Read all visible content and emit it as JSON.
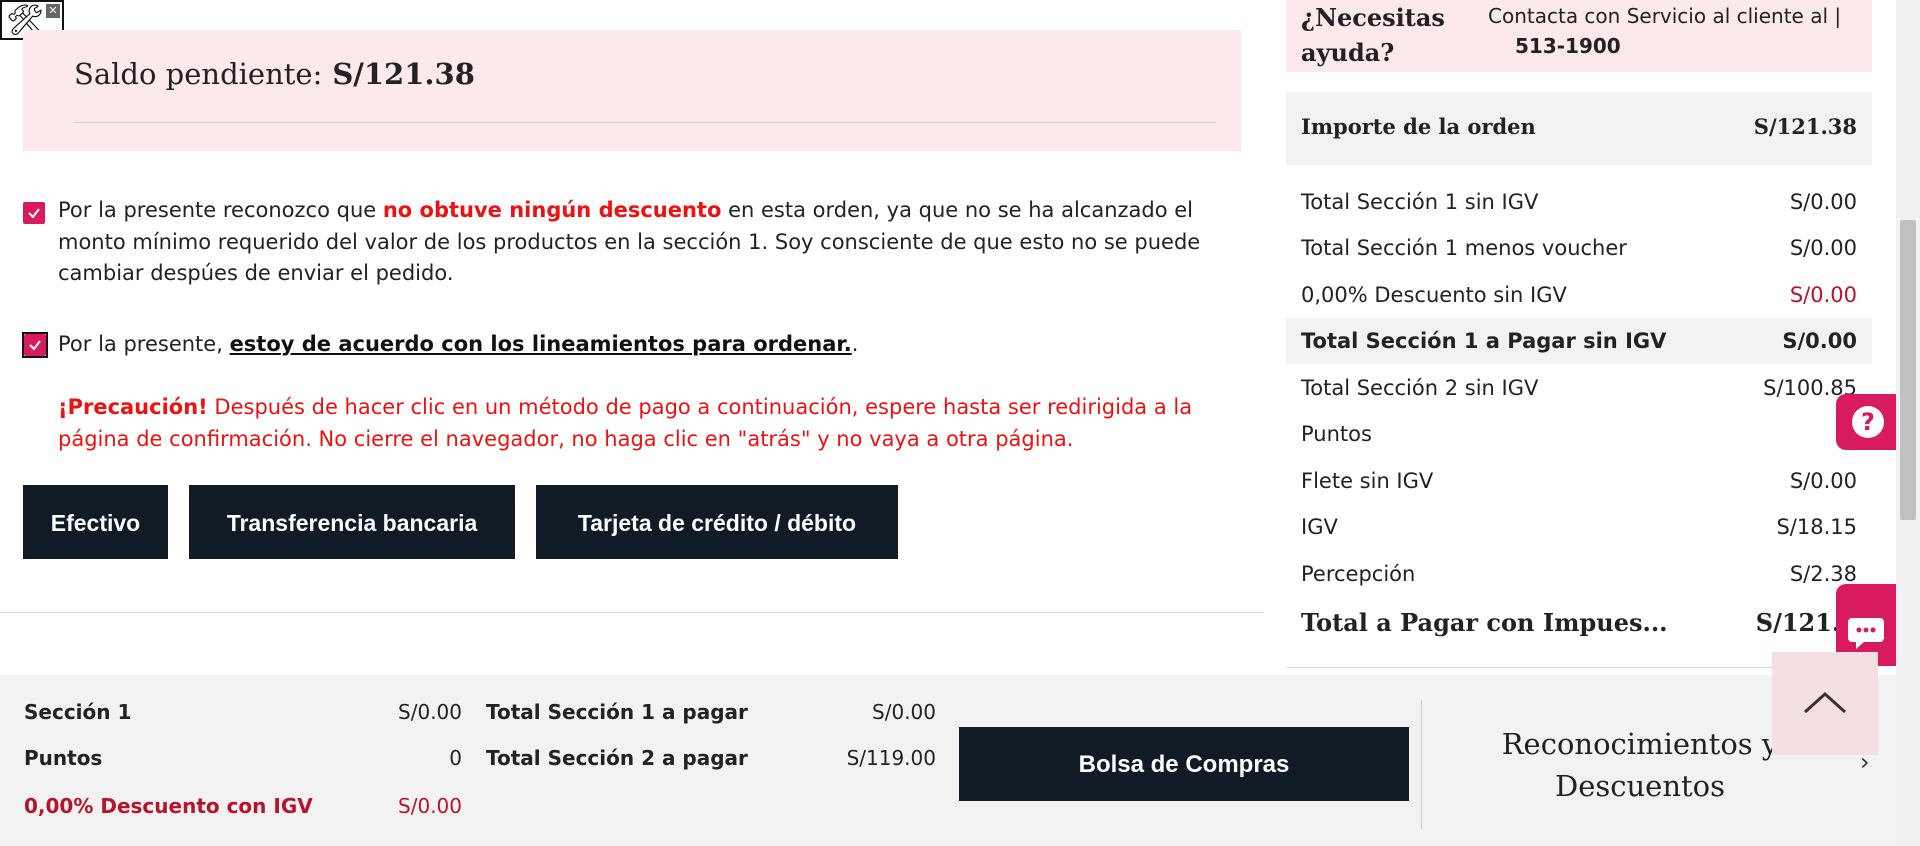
{
  "balance": {
    "label": "Saldo pendiente:",
    "value": "S/121.38"
  },
  "acknowledgement": {
    "part1": "Por la presente reconozco que ",
    "highlight": "no obtuve ningún descuento",
    "part2": " en esta orden, ya que no se ha alcanzado el monto mínimo requerido del valor de los productos en la sección 1. Soy consciente de que esto no se puede cambiar despúes de enviar el pedido."
  },
  "agreement": {
    "prefix": "Por la presente, ",
    "link": "estoy de acuerdo con los lineamientos para ordenar.",
    "suffix": "."
  },
  "caution": {
    "title": "¡Precaución!",
    "text": " Después de hacer clic en un método de pago a continuación, espere hasta ser redirigida a la página de confirmación. No cierre el navegador, no haga clic en \"atrás\" y no vaya a otra página."
  },
  "payment_buttons": {
    "cash": "Efectivo",
    "transfer": "Transferencia bancaria",
    "card": "Tarjeta de crédito / débito"
  },
  "help": {
    "title": "¿Necesitas ayuda?",
    "text": "Contacta con Servicio al cliente al |",
    "phone": "513-1900"
  },
  "order": {
    "header_label": "Importe de la orden",
    "header_value": "S/121.38",
    "rows": [
      {
        "label": "Total Sección 1 sin IGV",
        "value": "S/0.00"
      },
      {
        "label": "Total Sección 1 menos voucher",
        "value": "S/0.00"
      },
      {
        "label": "0,00% Descuento sin IGV",
        "value": "S/0.00"
      },
      {
        "label": "Total Sección 1 a Pagar sin IGV",
        "value": "S/0.00"
      },
      {
        "label": "Total Sección 2 sin IGV",
        "value": "S/100.85"
      },
      {
        "label": "Puntos",
        "value": ""
      },
      {
        "label": "Flete sin IGV",
        "value": "S/0.00"
      },
      {
        "label": "IGV",
        "value": "S/18.15"
      },
      {
        "label": "Percepción",
        "value": "S/2.38"
      }
    ],
    "total_label": "Total a Pagar con Impues...",
    "total_value": "S/121.3"
  },
  "bottom": {
    "seccion1_label": "Sección 1",
    "seccion1_value": "S/0.00",
    "puntos_label": "Puntos",
    "puntos_value": "0",
    "descuento_label": "0,00% Descuento con IGV",
    "descuento_value": "S/0.00",
    "total1_label": "Total Sección 1 a pagar",
    "total1_value": "S/0.00",
    "total2_label": "Total Sección 2 a pagar",
    "total2_value": "S/119.00",
    "bag_button": "Bolsa de Compras",
    "recognition": "Reconocimientos y Descuentos"
  },
  "colors": {
    "accent": "#d81b60",
    "dark_button": "#111b25",
    "pink_bg": "#fbe9eb",
    "warning_red": "#e11111"
  },
  "icons": [
    "wrench-screwdriver-icon",
    "close-icon",
    "checkmark-icon",
    "question-icon",
    "chat-icon",
    "chevron-up-icon",
    "chevron-right-icon"
  ]
}
